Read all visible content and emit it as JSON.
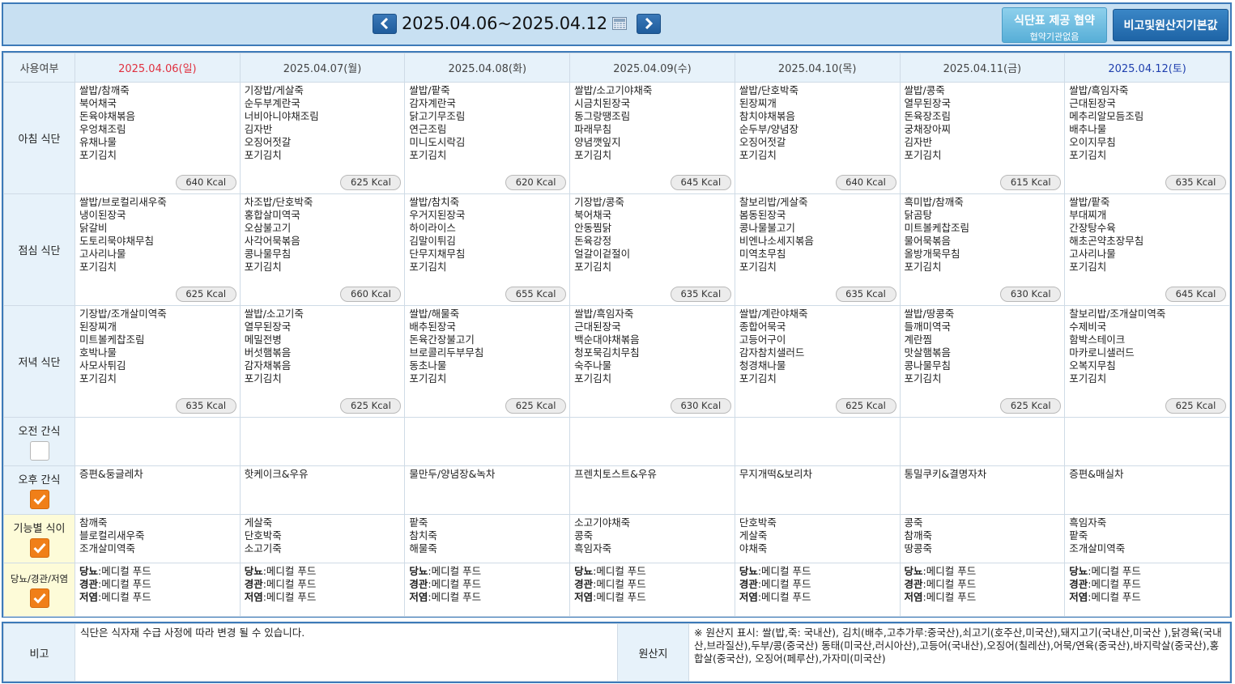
{
  "header": {
    "date_range": "2025.04.06~2025.04.12",
    "prev_icon": "chevron-left-icon",
    "next_icon": "chevron-right-icon",
    "calendar_icon": "calendar-icon",
    "agree_button": {
      "title": "식단표 제공 협약",
      "subtitle": "협약기관없음"
    },
    "origin_button": "비고및원산지기본값"
  },
  "table": {
    "use_label": "사용여부",
    "days": [
      {
        "label": "2025.04.06(일)",
        "color": "#e0303f"
      },
      {
        "label": "2025.04.07(월)",
        "color": "#444444"
      },
      {
        "label": "2025.04.08(화)",
        "color": "#444444"
      },
      {
        "label": "2025.04.09(수)",
        "color": "#444444"
      },
      {
        "label": "2025.04.10(목)",
        "color": "#444444"
      },
      {
        "label": "2025.04.11(금)",
        "color": "#444444"
      },
      {
        "label": "2025.04.12(토)",
        "color": "#1f3fae"
      }
    ],
    "rows": {
      "breakfast": {
        "label": "아침 식단",
        "items": [
          [
            "쌀밥/참깨죽",
            "북어채국",
            "돈육야채볶음",
            "우엉채조림",
            "유채나물",
            "포기김치"
          ],
          [
            "기장밥/게살죽",
            "순두부계란국",
            "너비아니야채조림",
            "김자반",
            "오징어젓갈",
            "포기김치"
          ],
          [
            "쌀밥/팥죽",
            "감자계란국",
            "닭고기무조림",
            "연근조림",
            "미니도시락김",
            "포기김치"
          ],
          [
            "쌀밥/소고기야채죽",
            "시금치된장국",
            "동그랑땡조림",
            "파래무침",
            "양념깻잎지",
            "포기김치"
          ],
          [
            "쌀밥/단호박죽",
            "된장찌개",
            "참치야채볶음",
            "순두부/양념장",
            "오징어젓갈",
            "포기김치"
          ],
          [
            "쌀밥/콩죽",
            "열무된장국",
            "돈육장조림",
            "궁채장아찌",
            "김자반",
            "포기김치"
          ],
          [
            "쌀밥/흑임자죽",
            "근대된장국",
            "메추리알모듬조림",
            "배추나물",
            "오이지무침",
            "포기김치"
          ]
        ],
        "kcal": [
          "640 Kcal",
          "625 Kcal",
          "620 Kcal",
          "645 Kcal",
          "640 Kcal",
          "615 Kcal",
          "635 Kcal"
        ]
      },
      "lunch": {
        "label": "점심 식단",
        "items": [
          [
            "쌀밥/브로컬리새우죽",
            "냉이된장국",
            "닭갈비",
            "도토리묵야채무침",
            "고사리나물",
            "포기김치"
          ],
          [
            "차조밥/단호박죽",
            "홍합살미역국",
            "오삼불고기",
            "사각어묵볶음",
            "콩나물무침",
            "포기김치"
          ],
          [
            "쌀밥/참치죽",
            "우거지된장국",
            "하이라이스",
            "김말이튀김",
            "단무지채무침",
            "포기김치"
          ],
          [
            "기장밥/콩죽",
            "북어채국",
            "안동찜닭",
            "돈육강정",
            "얼갈이겉절이",
            "포기김치"
          ],
          [
            "찰보리밥/게살죽",
            "봄동된장국",
            "콩나물불고기",
            "비엔나소세지볶음",
            "미역초무침",
            "포기김치"
          ],
          [
            "흑미밥/참깨죽",
            "닭곰탕",
            "미트볼케찹조림",
            "물어묵볶음",
            "올방개묵무침",
            "포기김치"
          ],
          [
            "쌀밥/팥죽",
            "부대찌개",
            "간장탕수육",
            "해초곤약초장무침",
            "고사리나물",
            "포기김치"
          ]
        ],
        "kcal": [
          "625 Kcal",
          "660 Kcal",
          "655 Kcal",
          "635 Kcal",
          "635 Kcal",
          "630 Kcal",
          "645 Kcal"
        ]
      },
      "dinner": {
        "label": "저녁 식단",
        "items": [
          [
            "기장밥/조개살미역죽",
            "된장찌개",
            "미트볼케찹조림",
            "호박나물",
            "사모사튀김",
            "포기김치"
          ],
          [
            "쌀밥/소고기죽",
            "열무된장국",
            "메밀전병",
            "버섯햄볶음",
            "감자채볶음",
            "포기김치"
          ],
          [
            "쌀밥/해물죽",
            "배추된장국",
            "돈육간장불고기",
            "브로콜리두부무침",
            "동초나물",
            "포기김치"
          ],
          [
            "쌀밥/흑임자죽",
            "근대된장국",
            "백순대야채볶음",
            "청포묵김치무침",
            "숙주나물",
            "포기김치"
          ],
          [
            "쌀밥/계란야채죽",
            "종합어묵국",
            "고등어구이",
            "감자참치샐러드",
            "청경채나물",
            "포기김치"
          ],
          [
            "쌀밥/땅콩죽",
            "들깨미역국",
            "계란찜",
            "맛살햄볶음",
            "콩나물무침",
            "포기김치"
          ],
          [
            "찰보리밥/조개살미역죽",
            "수제비국",
            "함박스테이크",
            "마카로니샐러드",
            "오복지무침",
            "포기김치"
          ]
        ],
        "kcal": [
          "635 Kcal",
          "625 Kcal",
          "625 Kcal",
          "630 Kcal",
          "625 Kcal",
          "625 Kcal",
          "625 Kcal"
        ]
      },
      "am_snack": {
        "label": "오전 간식",
        "checked": false,
        "items": [
          "",
          "",
          "",
          "",
          "",
          "",
          ""
        ]
      },
      "pm_snack": {
        "label": "오후 간식",
        "checked": true,
        "items": [
          "증편&둥글레차",
          "핫케이크&우유",
          "물만두/양념장&녹차",
          "프렌치토스트&우유",
          "무지개떡&보리차",
          "통밀쿠키&결명자차",
          "증편&매실차"
        ]
      },
      "functional": {
        "label": "기능별 식이",
        "checked": true,
        "items": [
          [
            "참깨죽",
            "블로컬리새우죽",
            "조개살미역죽"
          ],
          [
            "게살죽",
            "단호박죽",
            "소고기죽"
          ],
          [
            "팥죽",
            "참치죽",
            "해물죽"
          ],
          [
            "소고기야채죽",
            "콩죽",
            "흑임자죽"
          ],
          [
            "단호박죽",
            "게살죽",
            "야채죽"
          ],
          [
            "콩죽",
            "참깨죽",
            "땅콩죽"
          ],
          [
            "흑임자죽",
            "팥죽",
            "조개살미역죽"
          ]
        ]
      },
      "diet": {
        "label": "당뇨/경관/저염",
        "checked": true,
        "lines": [
          {
            "key": "당뇨",
            "value": ":메디컬 푸드"
          },
          {
            "key": "경관",
            "value": ":메디컬 푸드"
          },
          {
            "key": "저염",
            "value": ":메디컬 푸드"
          }
        ]
      }
    }
  },
  "note": {
    "remark_label": "비고",
    "remark_text": "식단은 식자재 수급 사정에 따라 변경 될 수 있습니다.",
    "origin_label": "원산지",
    "origin_text": "※ 원산지 표시: 쌀(밥,죽: 국내산), 김치(배추,고추가루:중국산),쇠고기(호주산,미국산),돼지고기(국내산,미국산 ),닭경육(국내산,브라질산),두부/콩(중국산) 동태(미국산,러시아산),고등어(국내산),오징어(칠레산),어묵/연육(중국산),바지락살(중국산),홍합살(중국산), 오징어(페루산),가자미(미국산)"
  }
}
